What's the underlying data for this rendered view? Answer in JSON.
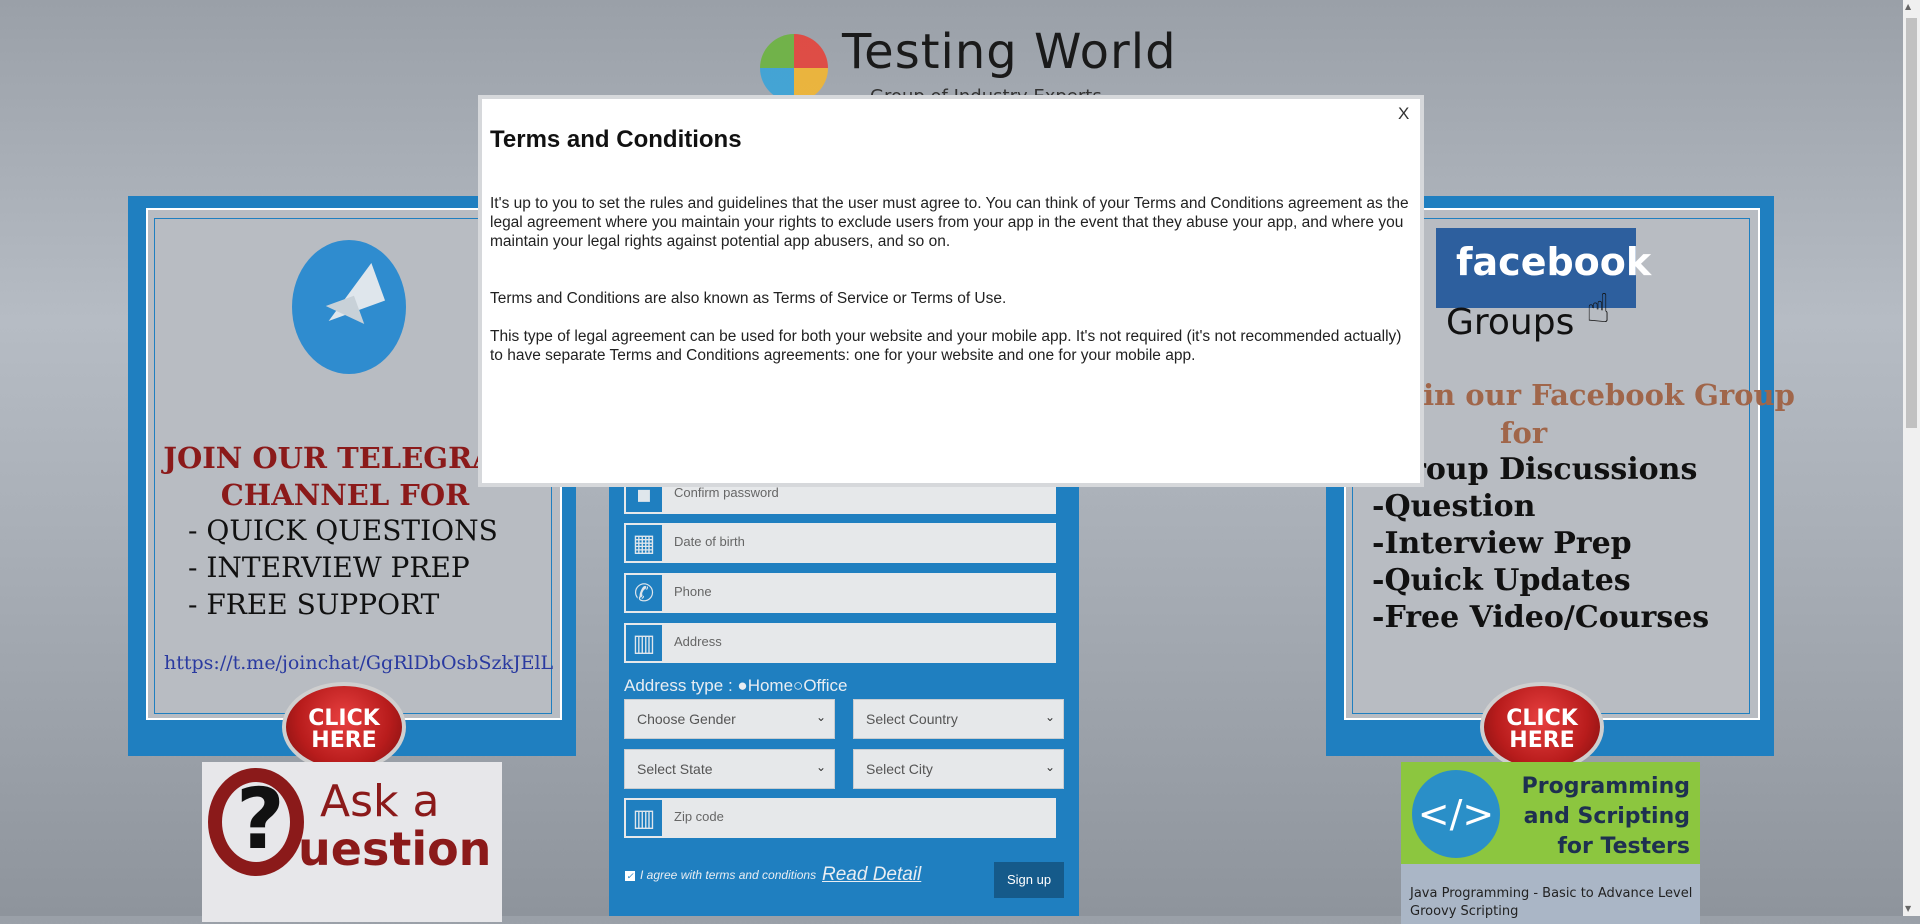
{
  "header": {
    "title": "Testing World",
    "subtitle": "Group of Industry Experts"
  },
  "telegram_panel": {
    "heading_line1": "JOIN OUR TELEGRAM",
    "heading_line2": "CHANNEL  FOR",
    "items": [
      "- QUICK QUESTIONS",
      "- INTERVIEW PREP",
      "- FREE SUPPORT"
    ],
    "link": "https://t.me/joinchat/GgRlDbOsbSzkJElL",
    "click_label": "CLICK HERE"
  },
  "ask_question": {
    "line1": "Ask a",
    "line2": "uestion"
  },
  "facebook_panel": {
    "logo_text": "facebook",
    "groups_text": "Groups",
    "heading_line1": "Join our Facebook Group",
    "heading_line2": "for",
    "items": [
      "-Group Discussions",
      "-Question",
      "-Interview Prep",
      "-Quick Updates",
      "-Free Video/Courses"
    ],
    "click_label": "CLICK HERE"
  },
  "programming_banner": {
    "icon_text": "</>",
    "text": "Programming and Scripting for Testers",
    "items": [
      "Java Programming - Basic to Advance Level",
      "Groovy Scripting"
    ]
  },
  "form": {
    "fields": [
      {
        "placeholder": "Confirm password",
        "icon": "lock-icon"
      },
      {
        "placeholder": "Date of birth",
        "icon": "calendar-icon"
      },
      {
        "placeholder": "Phone",
        "icon": "phone-icon"
      },
      {
        "placeholder": "Address",
        "icon": "map-icon"
      }
    ],
    "address_type_label": "Address type :",
    "address_home": "Home",
    "address_office": "Office",
    "gender": "Choose Gender",
    "country": "Select Country",
    "state": "Select State",
    "city": "Select City",
    "zip_placeholder": "Zip code",
    "agree_text": "I agree with terms and conditions",
    "read_detail": "Read Detail",
    "signup": "Sign up"
  },
  "modal": {
    "close": "X",
    "title": "Terms and Conditions",
    "p1": "It's up to you to set the rules and guidelines that the user must agree to. You can think of your Terms and Conditions agreement as the legal agreement where you maintain your rights to exclude users from your app in the event that they abuse your app, and where you maintain your legal rights against potential app abusers, and so on.",
    "p2": "Terms and Conditions are also known as Terms of Service or Terms of Use.",
    "p3": "This type of legal agreement can be used for both your website and your mobile app. It's not required (it's not recommended actually) to have separate Terms and Conditions agreements: one for your website and one for your mobile app."
  },
  "colors": {
    "accent": "#1f7fc0",
    "maroon": "#8b1a1a"
  }
}
